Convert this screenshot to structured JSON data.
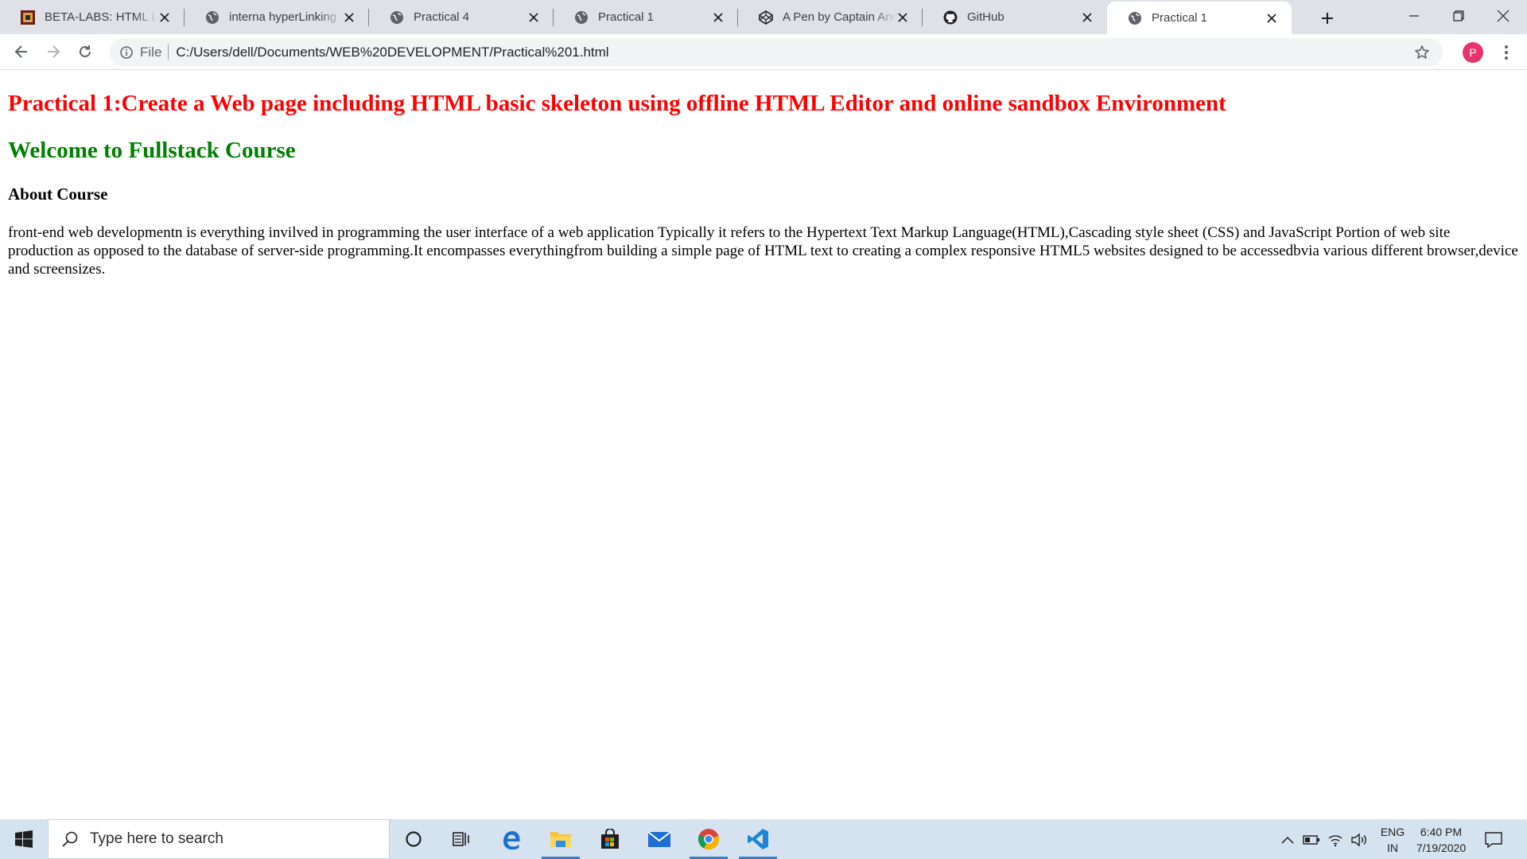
{
  "browser": {
    "tabs": [
      {
        "title": "BETA-LABS: HTML Link",
        "icon": "beta-labs-favicon"
      },
      {
        "title": "interna hyperLinking",
        "icon": "globe-icon"
      },
      {
        "title": "Practical 4",
        "icon": "globe-icon"
      },
      {
        "title": "Practical 1",
        "icon": "globe-icon"
      },
      {
        "title": "A Pen by Captain Anonymous",
        "icon": "codepen-icon"
      },
      {
        "title": "GitHub",
        "icon": "github-icon"
      },
      {
        "title": "Practical 1",
        "icon": "globe-icon",
        "active": true
      }
    ],
    "address": {
      "scheme_label": "File",
      "url": "C:/Users/dell/Documents/WEB%20DEVELOPMENT/Practical%201.html"
    },
    "profile_initial": "P"
  },
  "page": {
    "heading_practical": "Practical 1:Create a Web page including HTML basic skeleton using offline HTML Editor and online sandbox Environment",
    "heading_welcome": "Welcome to Fullstack Course",
    "heading_about": "About Course",
    "paragraph": "front-end web developmentn is everything invilved in programming the user interface of a web application Typically it refers to the Hypertext Text Markup Language(HTML),Cascading style sheet (CSS) and JavaScript Portion of web site production as opposed to the database of server-side programming.It encompasses everythingfrom building a simple page of HTML text to creating a complex responsive HTML5 websites designed to be accessedbvia various different browser,device and screensizes."
  },
  "taskbar": {
    "search_placeholder": "Type here to search",
    "lang_top": "ENG",
    "lang_bottom": "IN",
    "time": "6:40 PM",
    "date": "7/19/2020"
  },
  "colors": {
    "heading_red": "#ff0000",
    "heading_green": "#008000",
    "tabstrip_bg": "#dee1e6",
    "taskbar_bg": "#d5e3f0",
    "avatar_bg": "#e8336d"
  }
}
